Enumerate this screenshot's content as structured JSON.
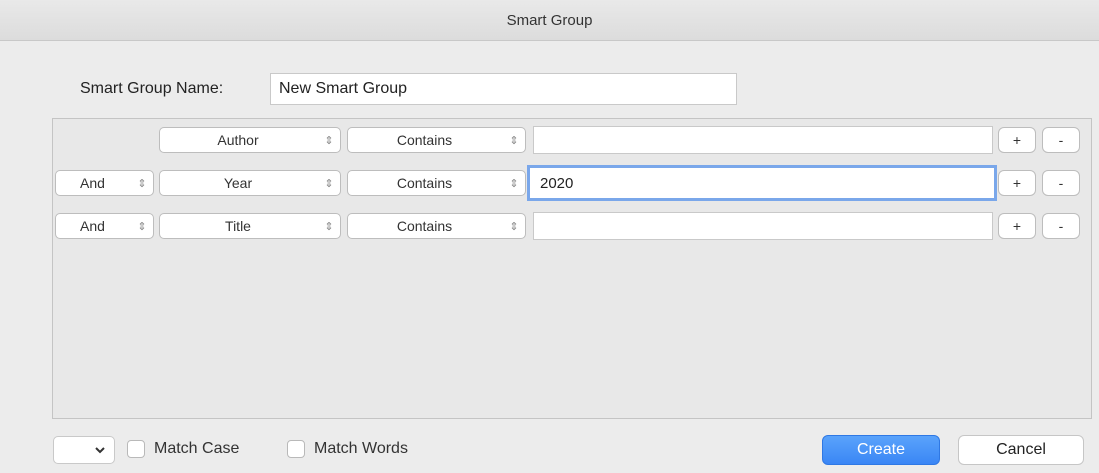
{
  "window": {
    "title": "Smart Group"
  },
  "name": {
    "label": "Smart Group Name:",
    "value": "New Smart Group"
  },
  "rules": [
    {
      "conjunction": "",
      "field": "Author",
      "operator": "Contains",
      "value": "",
      "add_label": "+",
      "remove_label": "-"
    },
    {
      "conjunction": "And",
      "field": "Year",
      "operator": "Contains",
      "value": "2020",
      "add_label": "+",
      "remove_label": "-"
    },
    {
      "conjunction": "And",
      "field": "Title",
      "operator": "Contains",
      "value": "",
      "add_label": "+",
      "remove_label": "-"
    }
  ],
  "footer": {
    "match_case_label": "Match Case",
    "match_words_label": "Match Words",
    "create_label": "Create",
    "cancel_label": "Cancel"
  },
  "colors": {
    "accent": "#3a86f5",
    "focus_ring": "#7aa7ea"
  }
}
